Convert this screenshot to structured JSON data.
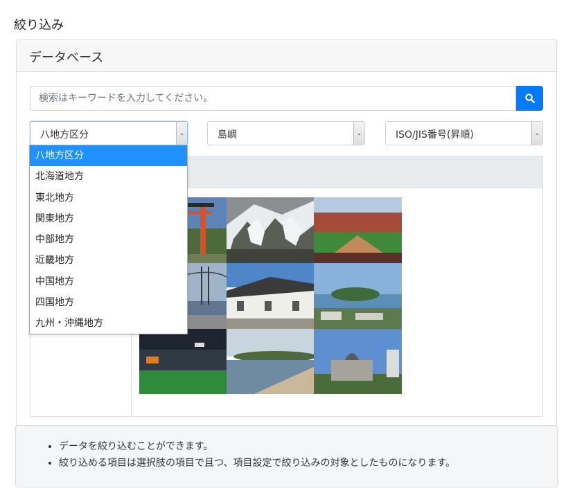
{
  "page": {
    "title": "絞り込み"
  },
  "card": {
    "header": "データベース"
  },
  "search": {
    "placeholder": "検索はキーワードを入力してください。",
    "button_icon": "search-icon"
  },
  "filters": {
    "region": {
      "selected": "八地方区分"
    },
    "category": {
      "selected": "島嶼"
    },
    "sort": {
      "selected": "ISO/JIS番号(昇順)"
    }
  },
  "region_dropdown": {
    "options": [
      "八地方区分",
      "北海道地方",
      "東北地方",
      "関東地方",
      "中部地方",
      "近畿地方",
      "中国地方",
      "四国地方",
      "九州・沖縄地方"
    ],
    "highlighted_index": 0
  },
  "photos": [
    "torii-gate",
    "snowy-mountain-slopes",
    "baseball-stadium",
    "bridge-over-sea",
    "white-walled-storehouses",
    "island-bay-view",
    "soccer-stadium",
    "sandy-beach",
    "atomic-bomb-dome"
  ],
  "info": {
    "items": [
      "データを絞り込むことができます。",
      "絞り込める項目は選択肢の項目で且つ、項目設定で絞り込みの対象としたものになります。"
    ]
  },
  "colors": {
    "accent": "#007bff",
    "dropdown_highlight": "#1e90ff",
    "info_bg": "#f5f6f7"
  }
}
